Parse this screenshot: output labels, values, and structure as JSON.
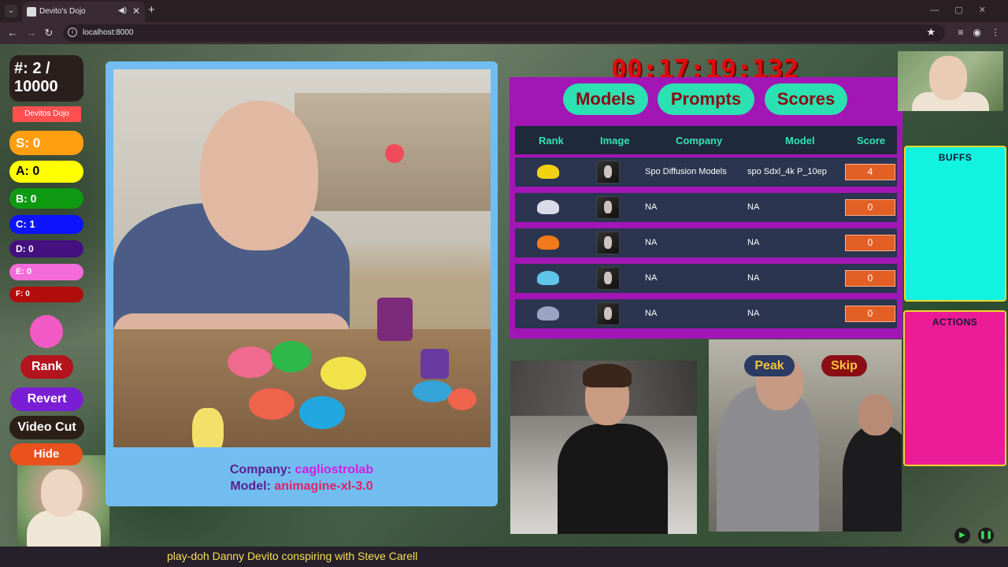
{
  "browser": {
    "tab_title": "Devito's Dojo",
    "url": "localhost:8000",
    "new_tab_symbol": "+",
    "tab_close_symbol": "✕"
  },
  "left": {
    "counter_line1": "#: 2 /",
    "counter_line2": "10000",
    "dojo_label": "Devitos Dojo",
    "grades": {
      "s": "S: 0",
      "a": "A: 0",
      "b": "B: 0",
      "c": "C: 1",
      "d": "D: 0",
      "e": "E: 0",
      "f": "F: 0"
    },
    "rank_label": "Rank",
    "revert_label": "Revert",
    "video_cut_label": "Video Cut",
    "hide_label": "Hide"
  },
  "main_image": {
    "company_label": "Company:",
    "company_value": "cagliostrolab",
    "model_label": "Model:",
    "model_value": "animagine-xl-3.0"
  },
  "timer": "00:17:19:132",
  "board": {
    "tabs": [
      "Models",
      "Prompts",
      "Scores"
    ],
    "headers": {
      "rank": "Rank",
      "image": "Image",
      "company": "Company",
      "model": "Model",
      "score": "Score"
    },
    "rows": [
      {
        "company": "Spo Diffusion Models",
        "model": "spo Sdxl_4k P_10ep",
        "score": "4",
        "rank_color": "#f2d112"
      },
      {
        "company": "NA",
        "model": "NA",
        "score": "0",
        "rank_color": "#d9dce6"
      },
      {
        "company": "NA",
        "model": "NA",
        "score": "0",
        "rank_color": "#f27a1b"
      },
      {
        "company": "NA",
        "model": "NA",
        "score": "0",
        "rank_color": "#5fc4e8"
      },
      {
        "company": "NA",
        "model": "NA",
        "score": "0",
        "rank_color": "#9aa4c3"
      }
    ]
  },
  "video": {
    "peak_label": "Peak",
    "skip_label": "Skip"
  },
  "panels": {
    "buffs_title": "BUFFS",
    "actions_title": "ACTIONS"
  },
  "prompt_caption": "play-doh Danny Devito conspiring with Steve Carell",
  "colors": {
    "board_bg": "#a216b6",
    "tab_bg": "#2be0b1",
    "timer": "#e20b0b",
    "buffs_bg": "#12f2e1",
    "actions_bg": "#ec1b97"
  }
}
